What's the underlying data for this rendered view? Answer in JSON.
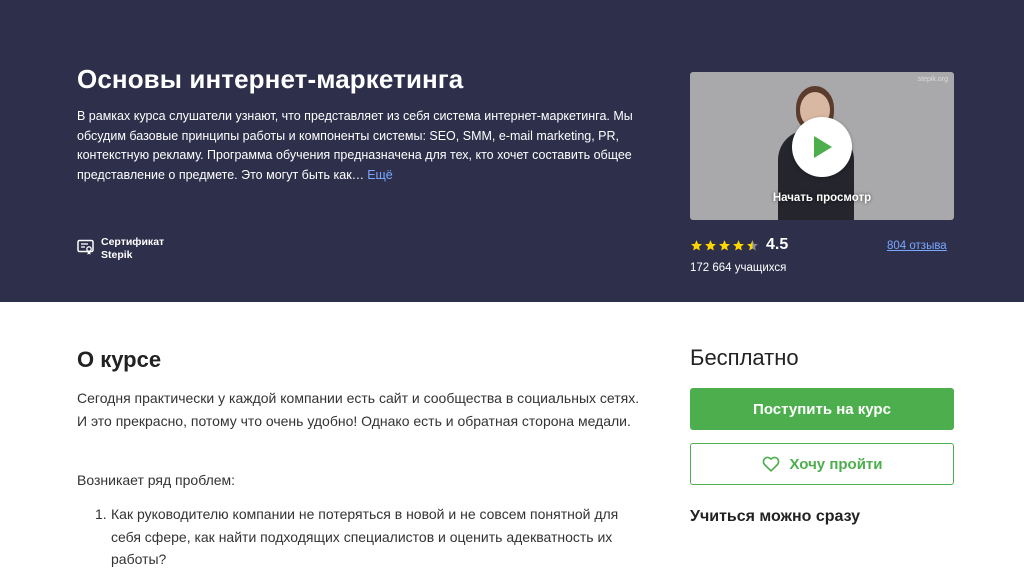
{
  "hero": {
    "title": "Основы интернет-маркетинга",
    "description": "В рамках курса слушатели узнают, что представляет из себя система интернет-маркетинга. Мы обсудим базовые принципы работы и компоненты системы: SEO, SMM, e-mail marketing, PR, контекстную рекламу. Программа обучения предназначена для тех, кто хочет составить общее представление о предмете. Это могут быть как…",
    "more_link": "Ещё",
    "certificate_line1": "Сертификат",
    "certificate_line2": "Stepik",
    "background_color": "#2d2f4b"
  },
  "video": {
    "watermark": "stepik.org",
    "play_label": "Начать просмотр",
    "play_icon": "play-icon"
  },
  "rating": {
    "stars": 4.5,
    "value": "4.5",
    "reviews": "804 отзыва",
    "learners": "172 664 учащихся",
    "star_color": "#ffd700"
  },
  "about": {
    "title": "О курсе",
    "paragraph1": "Сегодня практически у каждой компании есть сайт и сообщества в социальных сетях. И это прекрасно, потому что очень удобно! Однако есть и обратная сторона медали.",
    "paragraph2": "Возникает ряд проблем:",
    "problems": [
      {
        "num": "1.",
        "text": "Как руководителю компании не потеряться в новой и не совсем понятной для себя сфере, как найти подходящих специалистов и оценить адекватность их работы?"
      }
    ]
  },
  "sidebar": {
    "price": "Бесплатно",
    "enroll_label": "Поступить на курс",
    "wishlist_label": "Хочу пройти",
    "wishlist_icon": "heart-icon",
    "start_now": "Учиться можно сразу",
    "accent_color": "#4cae4c"
  }
}
